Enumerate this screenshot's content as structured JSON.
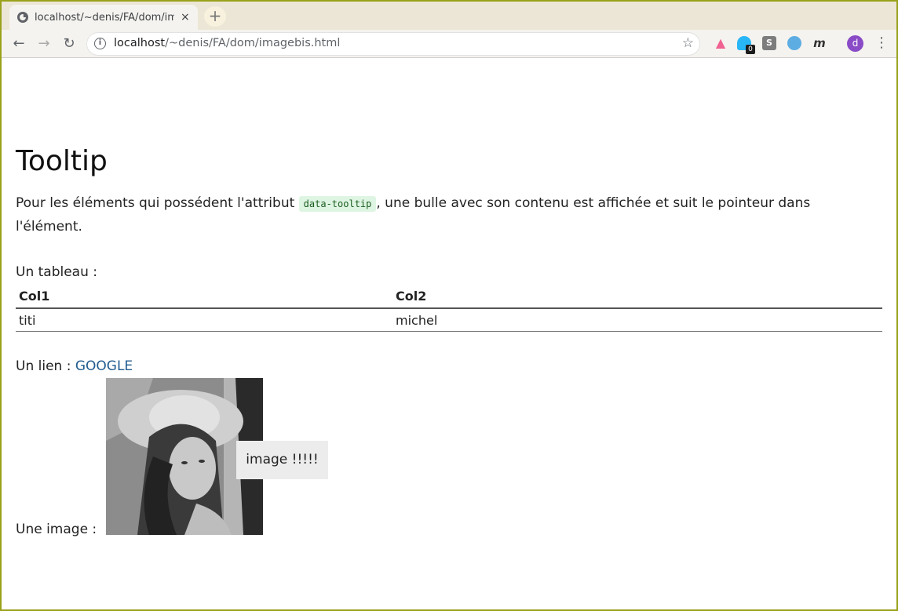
{
  "browser": {
    "tab_title": "localhost/~denis/FA/dom/imagebis.html",
    "tab_close": "×",
    "new_tab": "+",
    "url_host": "localhost",
    "url_path": "/~denis/FA/dom/imagebis.html",
    "info_icon": "i",
    "extensions": [
      {
        "name": "pink-extension-icon",
        "label": "",
        "color": "#f06292"
      },
      {
        "name": "ghost-extension-icon",
        "label": "",
        "color": "#29b6f6"
      },
      {
        "name": "s-extension-icon",
        "label": "S",
        "color": "#7d7d7d"
      },
      {
        "name": "bird-extension-icon",
        "label": "",
        "color": "#5dade2"
      },
      {
        "name": "m-extension-icon",
        "label": "m",
        "color": "#f5f3ef"
      }
    ],
    "badge_count": "0",
    "avatar_letter": "d"
  },
  "page": {
    "title": "Tooltip",
    "intro_before": "Pour les éléments qui possédent l'attribut ",
    "intro_code": "data-tooltip",
    "intro_after": ", une bulle avec son contenu est affichée et suit le pointeur dans l'élément.",
    "table_label": "Un tableau :",
    "table": {
      "headers": [
        "Col1",
        "Col2"
      ],
      "rows": [
        [
          "titi",
          "michel"
        ]
      ]
    },
    "link_label": "Un lien : ",
    "link_text": "GOOGLE",
    "image_label": "Une image :",
    "tooltip_text": "image !!!!!"
  }
}
